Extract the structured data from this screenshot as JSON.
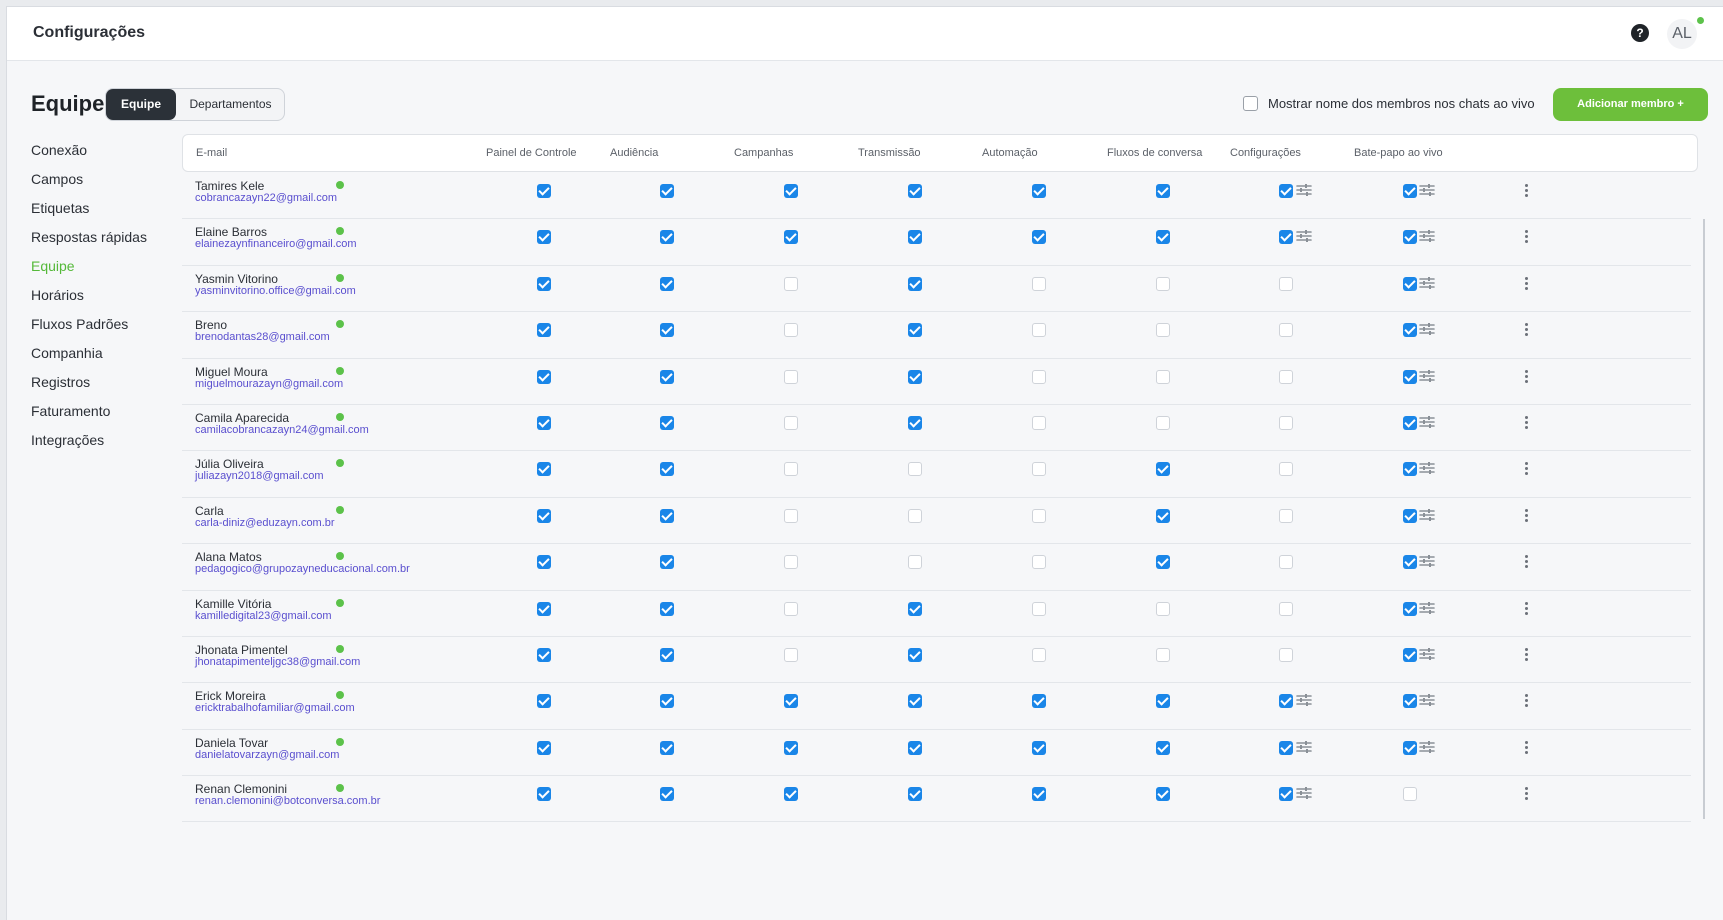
{
  "header": {
    "title": "Configurações",
    "help_icon": "question-circle-icon",
    "avatar": "AL"
  },
  "section": {
    "title": "Equipe",
    "tabs": [
      "Equipe",
      "Departamentos"
    ]
  },
  "show_names_label": "Mostrar nome dos membros nos chats ao vivo",
  "add_member_label": "Adicionar membro +",
  "sidebar": {
    "items": [
      "Conexão",
      "Campos",
      "Etiquetas",
      "Respostas rápidas",
      "Equipe",
      "Horários",
      "Fluxos Padrões",
      "Companhia",
      "Registros",
      "Faturamento",
      "Integrações"
    ],
    "active": "Equipe"
  },
  "table": {
    "headers": [
      "E-mail",
      "Painel de Controle",
      "Audiência",
      "Campanhas",
      "Transmissão",
      "Automação",
      "Fluxos de conversa",
      "Configurações",
      "Bate-papo ao vivo"
    ],
    "rows": [
      {
        "name": "Tamires Kele",
        "email": "cobrancazayn22@gmail.com",
        "perms": [
          1,
          1,
          1,
          1,
          1,
          1,
          1,
          1
        ]
      },
      {
        "name": "Elaine Barros",
        "email": "elainezaynfinanceiro@gmail.com",
        "perms": [
          1,
          1,
          1,
          1,
          1,
          1,
          1,
          1
        ]
      },
      {
        "name": "Yasmin Vitorino",
        "email": "yasminvitorino.office@gmail.com",
        "perms": [
          1,
          1,
          0,
          1,
          0,
          0,
          0,
          1
        ]
      },
      {
        "name": "Breno",
        "email": "brenodantas28@gmail.com",
        "perms": [
          1,
          1,
          0,
          1,
          0,
          0,
          0,
          1
        ]
      },
      {
        "name": "Miguel Moura",
        "email": "miguelmourazayn@gmail.com",
        "perms": [
          1,
          1,
          0,
          1,
          0,
          0,
          0,
          1
        ]
      },
      {
        "name": "Camila Aparecida",
        "email": "camilacobrancazayn24@gmail.com",
        "perms": [
          1,
          1,
          0,
          1,
          0,
          0,
          0,
          1
        ]
      },
      {
        "name": "Júlia Oliveira",
        "email": "juliazayn2018@gmail.com",
        "perms": [
          1,
          1,
          0,
          0,
          0,
          1,
          0,
          1
        ]
      },
      {
        "name": "Carla",
        "email": "carla-diniz@eduzayn.com.br",
        "perms": [
          1,
          1,
          0,
          0,
          0,
          1,
          0,
          1
        ]
      },
      {
        "name": "Alana Matos",
        "email": "pedagogico@grupozayneducacional.com.br",
        "perms": [
          1,
          1,
          0,
          0,
          0,
          1,
          0,
          1
        ]
      },
      {
        "name": "Kamille Vitória",
        "email": "kamilledigital23@gmail.com",
        "perms": [
          1,
          1,
          0,
          1,
          0,
          0,
          0,
          1
        ]
      },
      {
        "name": "Jhonata Pimentel",
        "email": "jhonatapimenteljgc38@gmail.com",
        "perms": [
          1,
          1,
          0,
          1,
          0,
          0,
          0,
          1
        ]
      },
      {
        "name": "Erick Moreira",
        "email": "ericktrabalhofamiliar@gmail.com",
        "perms": [
          1,
          1,
          1,
          1,
          1,
          1,
          1,
          1
        ]
      },
      {
        "name": "Daniela Tovar",
        "email": "danielatovarzayn@gmail.com",
        "perms": [
          1,
          1,
          1,
          1,
          1,
          1,
          1,
          1
        ]
      },
      {
        "name": "Renan Clemonini",
        "email": "renan.clemonini@botconversa.com.br",
        "perms": [
          1,
          1,
          1,
          1,
          1,
          1,
          1,
          0
        ]
      }
    ]
  },
  "colors": {
    "accent_green": "#6dbf3b",
    "checkbox_blue": "#1a86e8",
    "email_purple": "#5a4fcf",
    "online_green": "#5cc24a"
  },
  "icons": {
    "settings_adjust": "sliders-icon",
    "row_menu": "more-vertical-icon",
    "status": "online-dot-icon"
  }
}
